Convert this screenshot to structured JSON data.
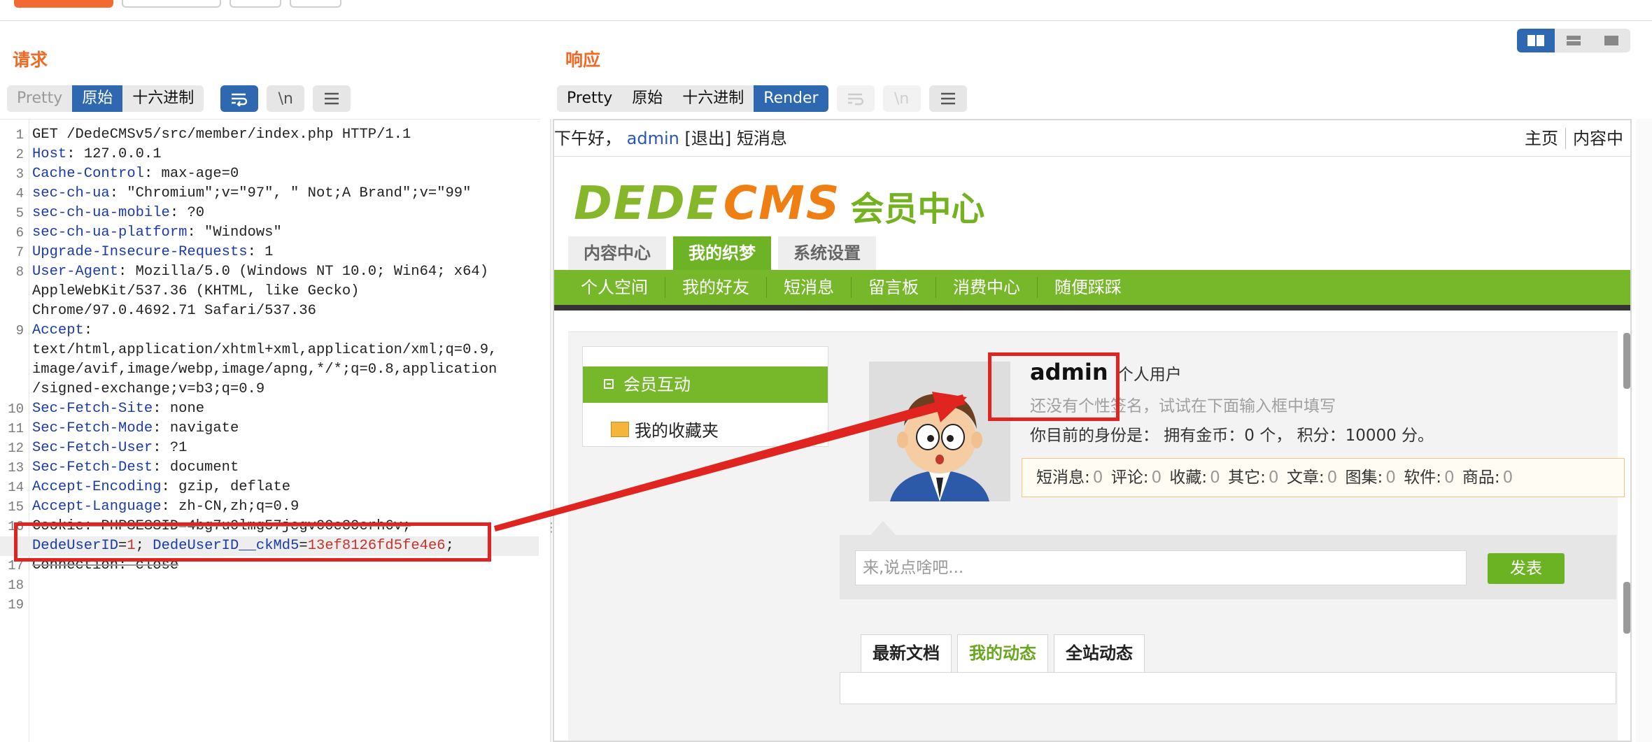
{
  "request": {
    "title": "请求",
    "tabs": [
      "Pretty",
      "原始",
      "十六进制"
    ],
    "active_tab": "原始",
    "newline_button": "\\n",
    "lines": [
      {
        "num": "1",
        "key": "",
        "text": "GET /DedeCMSv5/src/member/index.php HTTP/1.1"
      },
      {
        "num": "2",
        "key": "Host",
        "text": ": 127.0.0.1"
      },
      {
        "num": "3",
        "key": "Cache-Control",
        "text": ": max-age=0"
      },
      {
        "num": "4",
        "key": "sec-ch-ua",
        "text": ": \"Chromium\";v=\"97\", \" Not;A Brand\";v=\"99\""
      },
      {
        "num": "5",
        "key": "sec-ch-ua-mobile",
        "text": ": ?0"
      },
      {
        "num": "6",
        "key": "sec-ch-ua-platform",
        "text": ": \"Windows\""
      },
      {
        "num": "7",
        "key": "Upgrade-Insecure-Requests",
        "text": ": 1"
      },
      {
        "num": "8",
        "key": "User-Agent",
        "text": ": Mozilla/5.0 (Windows NT 10.0; Win64; x64)"
      },
      {
        "num": "",
        "key": "",
        "text": "AppleWebKit/537.36 (KHTML, like Gecko)"
      },
      {
        "num": "",
        "key": "",
        "text": "Chrome/97.0.4692.71 Safari/537.36"
      },
      {
        "num": "9",
        "key": "Accept",
        "text": ":"
      },
      {
        "num": "",
        "key": "",
        "text": "text/html,application/xhtml+xml,application/xml;q=0.9,"
      },
      {
        "num": "",
        "key": "",
        "text": "image/avif,image/webp,image/apng,*/*;q=0.8,application"
      },
      {
        "num": "",
        "key": "",
        "text": "/signed-exchange;v=b3;q=0.9"
      },
      {
        "num": "10",
        "key": "Sec-Fetch-Site",
        "text": ": none"
      },
      {
        "num": "11",
        "key": "Sec-Fetch-Mode",
        "text": ": navigate"
      },
      {
        "num": "12",
        "key": "Sec-Fetch-User",
        "text": ": ?1"
      },
      {
        "num": "13",
        "key": "Sec-Fetch-Dest",
        "text": ": document"
      },
      {
        "num": "14",
        "key": "Accept-Encoding",
        "text": ": gzip, deflate"
      },
      {
        "num": "15",
        "key": "Accept-Language",
        "text": ": zh-CN,zh;q=0.9"
      }
    ],
    "cookie_line_num": "16",
    "cookie_blurred": "Cookie: PHPSESSID=4bg7u0lmg57jcgv00c30crh6v;",
    "cookie_parts": {
      "k1": "DedeUserID",
      "v1": "1",
      "k2": "DedeUserID__ckMd5",
      "v2": "13ef8126fd5fe4e6"
    },
    "line17": {
      "num": "17",
      "text": "Connection: close"
    },
    "line18": "18",
    "line19": "19"
  },
  "response": {
    "title": "响应",
    "tabs": [
      "Pretty",
      "原始",
      "十六进制",
      "Render"
    ],
    "active_tab": "Render",
    "newline_button": "\\n"
  },
  "page": {
    "greeting": "下午好，",
    "user": "admin",
    "logout": "[退出]",
    "messages": "短消息",
    "top_links": [
      "主页",
      "内容中"
    ],
    "logo_dede": "DEDE",
    "logo_cms": "CMS",
    "logo_cn": "会员中心",
    "main_tabs": [
      "内容中心",
      "我的织梦",
      "系统设置"
    ],
    "active_main_tab": "我的织梦",
    "sub_nav": [
      "个人空间",
      "我的好友",
      "短消息",
      "留言板",
      "消费中心",
      "随便踩踩"
    ],
    "side_head": "会员互动",
    "side_item": "我的收藏夹",
    "username": "admin",
    "user_type": "个人用户",
    "signature": "还没有个性签名，试试在下面输入框中填写",
    "identity": "你目前的身份是： 拥有金币：0 个， 积分：10000 分。",
    "stats": [
      {
        "label": "短消息:",
        "value": "0"
      },
      {
        "label": "评论:",
        "value": "0"
      },
      {
        "label": "收藏:",
        "value": "0"
      },
      {
        "label": "其它:",
        "value": "0"
      },
      {
        "label": "文章:",
        "value": "0"
      },
      {
        "label": "图集:",
        "value": "0"
      },
      {
        "label": "软件:",
        "value": "0"
      },
      {
        "label": "商品:",
        "value": "0"
      }
    ],
    "post_placeholder": "来,说点啥吧...",
    "post_button": "发表",
    "feed_tabs": [
      "最新文档",
      "我的动态",
      "全站动态"
    ],
    "active_feed_tab": "我的动态"
  },
  "colors": {
    "accent_orange": "#f06a25",
    "active_blue": "#2e68b1",
    "dede_green": "#77b72a",
    "highlight_red": "#e0241f"
  }
}
